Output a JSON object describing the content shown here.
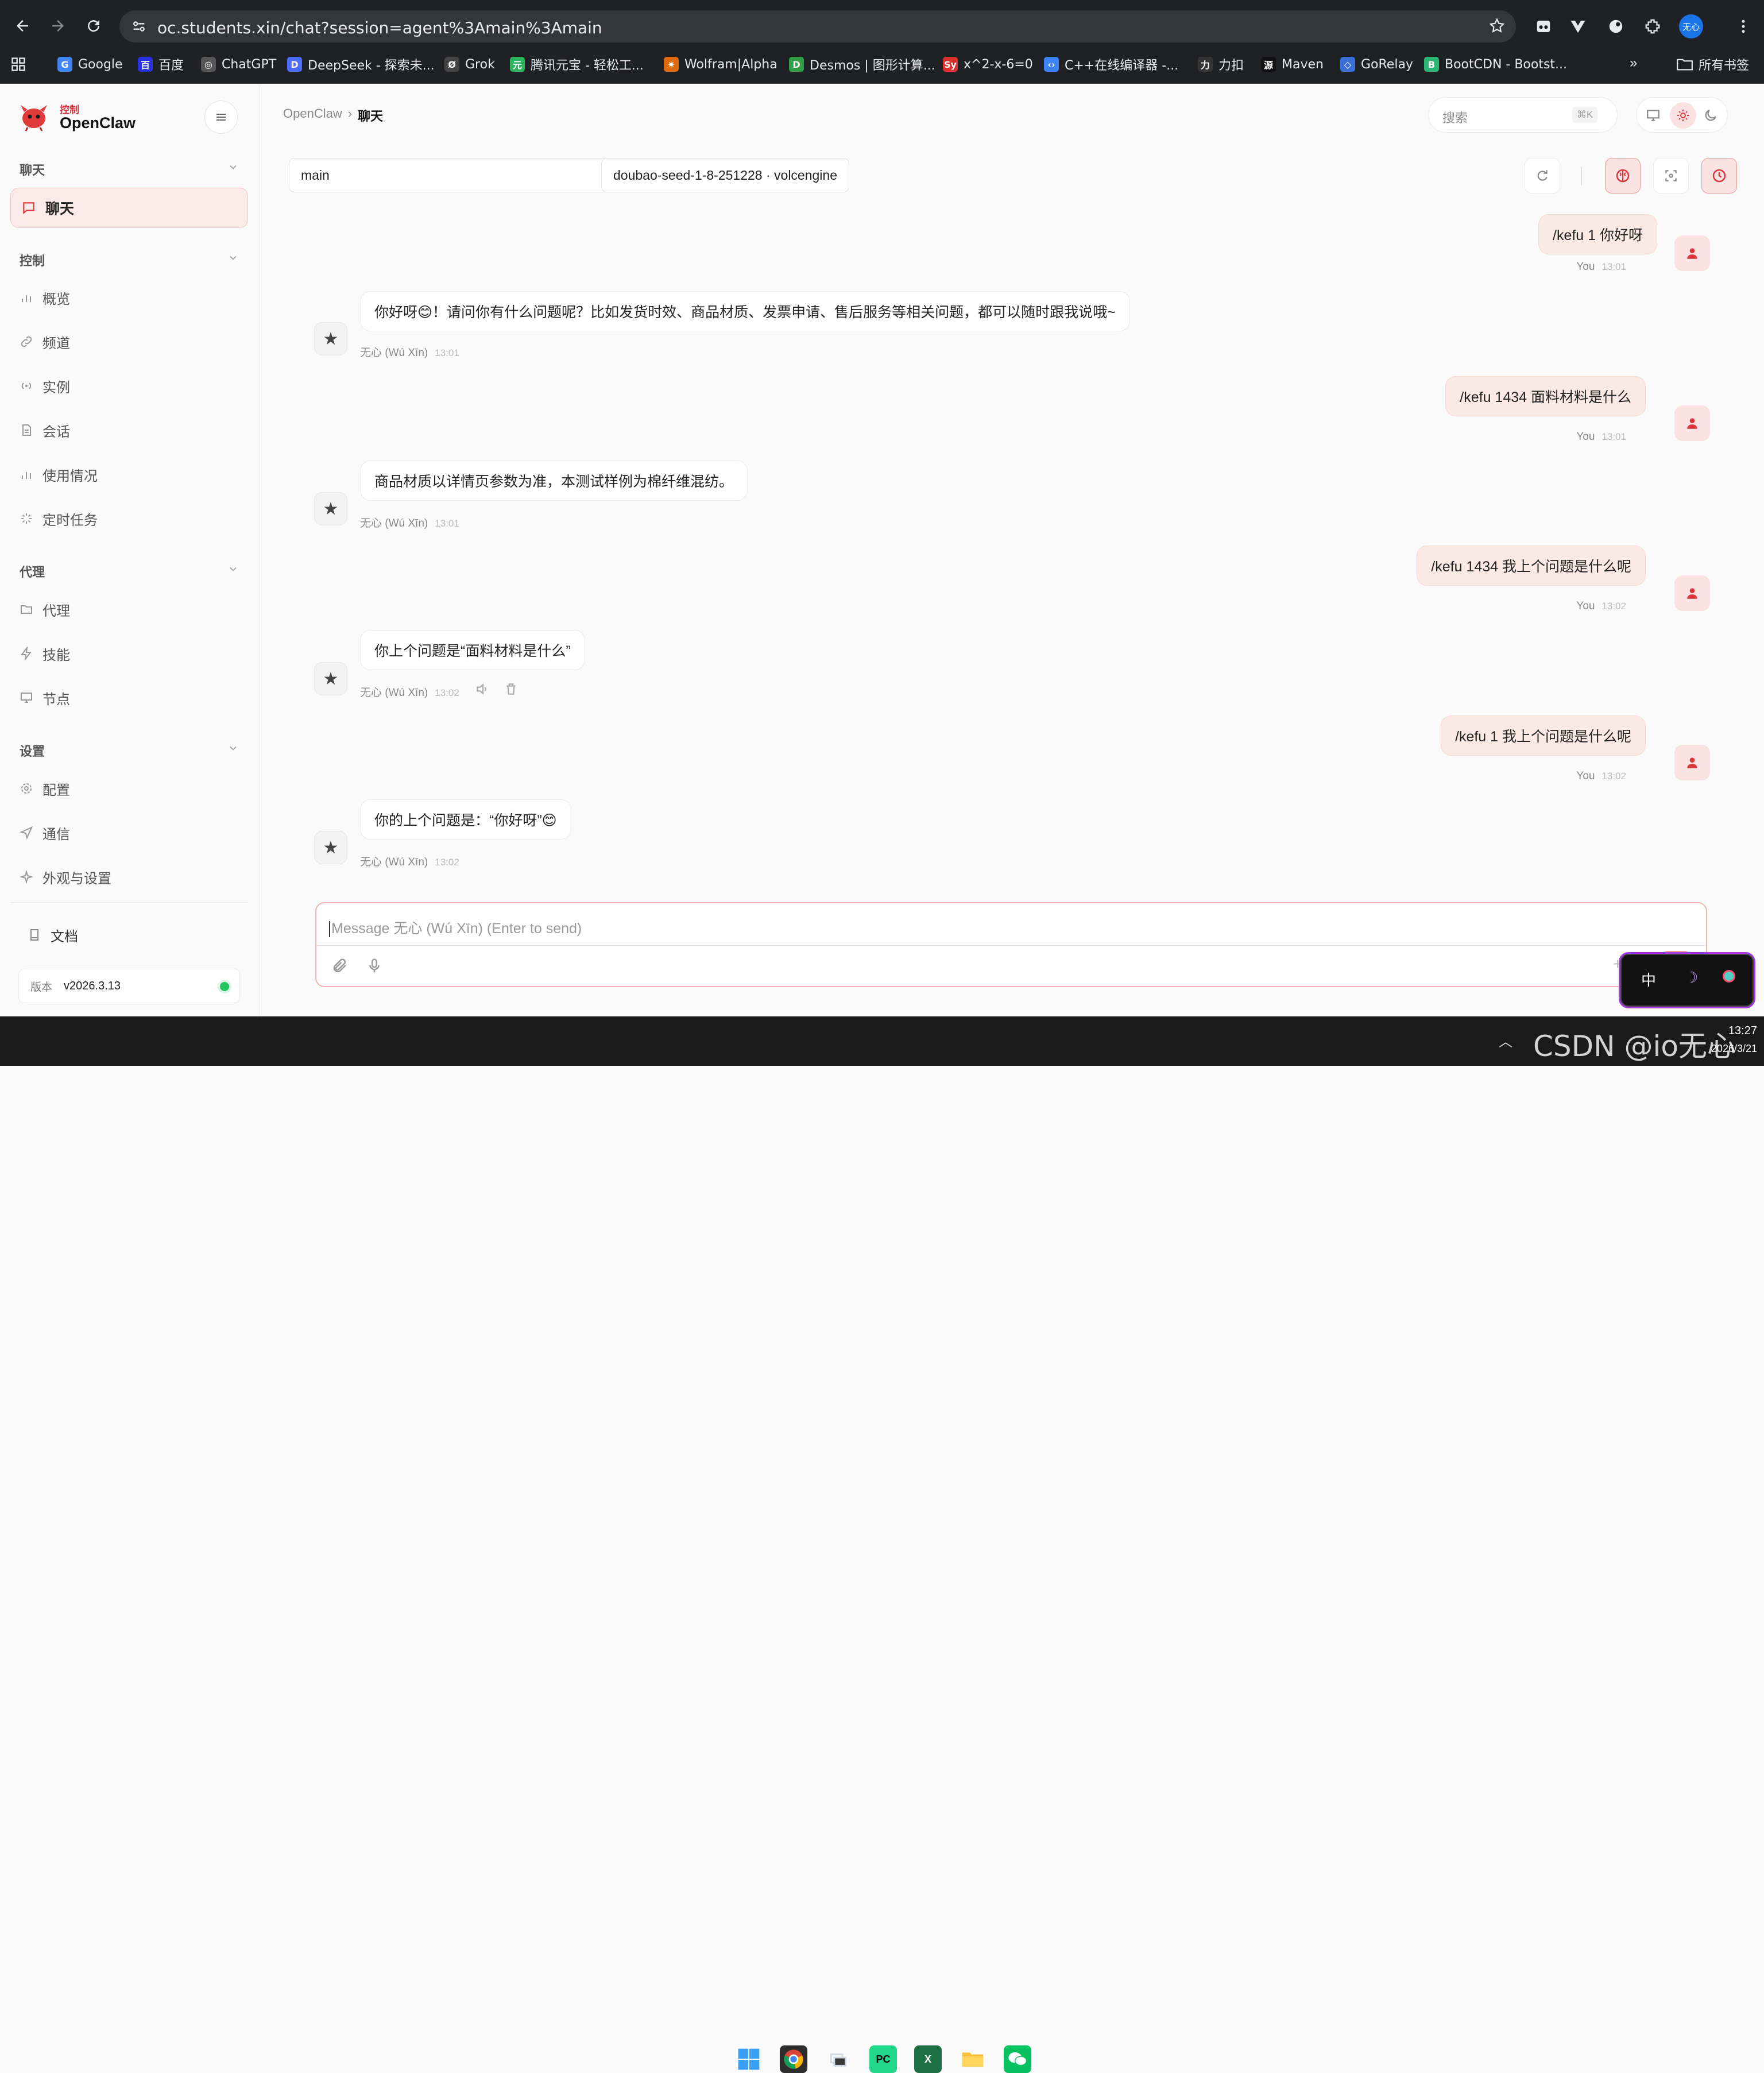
{
  "browser": {
    "url": "oc.students.xin/chat?session=agent%3Amain%3Amain",
    "profile_label": "无心",
    "bookmarks": [
      {
        "label": "Google",
        "color": "#4285f4",
        "glyph": "G"
      },
      {
        "label": "百度",
        "color": "#2932e1",
        "glyph": "百"
      },
      {
        "label": "ChatGPT",
        "color": "#555555",
        "glyph": "◎"
      },
      {
        "label": "DeepSeek - 探索未...",
        "color": "#4d6bfe",
        "glyph": "D"
      },
      {
        "label": "Grok",
        "color": "#444444",
        "glyph": "Ø"
      },
      {
        "label": "腾讯元宝 - 轻松工...",
        "color": "#2db55d",
        "glyph": "元"
      },
      {
        "label": "Wolfram|Alpha",
        "color": "#dd6b0d",
        "glyph": "✷"
      },
      {
        "label": "Desmos | 图形计算...",
        "color": "#2f9e44",
        "glyph": "D"
      },
      {
        "label": "x^2-x-6=0",
        "color": "#d9302c",
        "glyph": "Sy"
      },
      {
        "label": "C++在线编译器 -...",
        "color": "#3b82f6",
        "glyph": "‹›"
      },
      {
        "label": "力扣",
        "color": "#333333",
        "glyph": "力"
      },
      {
        "label": "Maven",
        "color": "#111111",
        "glyph": "源"
      },
      {
        "label": "GoRelay",
        "color": "#3b6fd8",
        "glyph": "◇"
      },
      {
        "label": "BootCDN - Bootst...",
        "color": "#2bb673",
        "glyph": "B"
      }
    ],
    "all_bookmarks_label": "所有书签"
  },
  "sidebar": {
    "brand_small": "控制",
    "brand_name": "OpenClaw",
    "sections": {
      "chat": "聊天",
      "control": "控制",
      "agent": "代理",
      "settings": "设置"
    },
    "active_item": "聊天",
    "control_items": [
      "概览",
      "频道",
      "实例",
      "会话",
      "使用情况",
      "定时任务"
    ],
    "agent_items": [
      "代理",
      "技能",
      "节点"
    ],
    "settings_items": [
      "配置",
      "通信",
      "外观与设置"
    ],
    "docs_label": "文档",
    "version_label": "版本",
    "version_value": "v2026.3.13",
    "status_color": "#22c55e"
  },
  "header": {
    "breadcrumb_root": "OpenClaw",
    "breadcrumb_sep": "›",
    "breadcrumb_current": "聊天",
    "search_placeholder": "搜索",
    "search_shortcut": "⌘K"
  },
  "session": {
    "agent_select": "main",
    "model_select": "doubao-seed-1-8-251228 · volcengine"
  },
  "messages": [
    {
      "role": "user",
      "text": "/kefu 1 你好呀",
      "sender": "You",
      "time": "13:01"
    },
    {
      "role": "assistant",
      "text": "你好呀😊！请问你有什么问题呢？比如发货时效、商品材质、发票申请、售后服务等相关问题，都可以随时跟我说哦~",
      "sender": "无心 (Wú Xīn)",
      "time": "13:01"
    },
    {
      "role": "user",
      "text": "/kefu 1434 面料材料是什么",
      "sender": "You",
      "time": "13:01"
    },
    {
      "role": "assistant",
      "text": "商品材质以详情页参数为准，本测试样例为棉纤维混纺。",
      "sender": "无心 (Wú Xīn)",
      "time": "13:01"
    },
    {
      "role": "user",
      "text": "/kefu 1434 我上个问题是什么呢",
      "sender": "You",
      "time": "13:02"
    },
    {
      "role": "assistant",
      "text": "你上个问题是“面料材料是什么”",
      "sender": "无心 (Wú Xīn)",
      "time": "13:02"
    },
    {
      "role": "user",
      "text": "/kefu 1 我上个问题是什么呢",
      "sender": "You",
      "time": "13:02"
    },
    {
      "role": "assistant",
      "text": "你的上个问题是：“你好呀”😊",
      "sender": "无心 (Wú Xīn)",
      "time": "13:02"
    }
  ],
  "composer": {
    "placeholder": "Message 无心 (Wú Xīn) (Enter to send)"
  },
  "ime": {
    "mode": "中"
  },
  "taskbar": {
    "time": "13:27",
    "date": "2026/3/21",
    "watermark": "CSDN @io无心"
  },
  "colors": {
    "accent": "#d9363e",
    "active_bg": "#fbeaea",
    "user_bubble": "#fbe9e3"
  }
}
